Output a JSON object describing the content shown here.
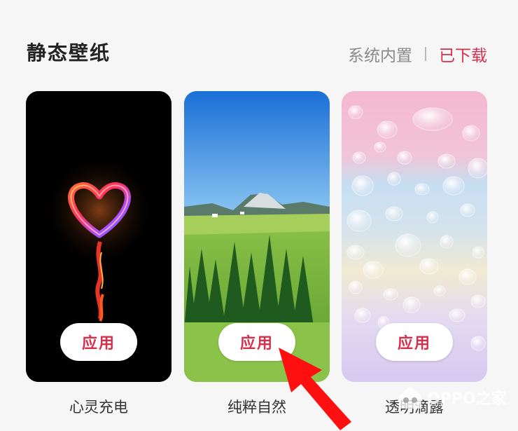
{
  "header": {
    "title": "静态壁纸",
    "tabs": [
      "系统内置",
      "已下载"
    ],
    "active_tab_index": 1
  },
  "colors": {
    "accent": "#d6304d",
    "background": "#f6f6f6"
  },
  "wallpapers": [
    {
      "name": "心灵充电",
      "apply_label": "应用",
      "image": "fire-heart-on-black"
    },
    {
      "name": "纯粹自然",
      "apply_label": "应用",
      "image": "mountain-meadow-landscape"
    },
    {
      "name": "透明滴露",
      "apply_label": "应用",
      "image": "water-droplets-pastel"
    }
  ],
  "watermark": {
    "text": "OPPO之家"
  },
  "annotation": {
    "icon": "red-arrow-icon"
  }
}
